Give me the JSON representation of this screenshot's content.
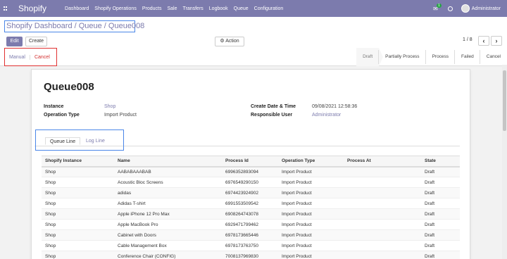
{
  "topbar": {
    "brand": "Shopify",
    "menu": [
      "Dashboard",
      "Shopify Operations",
      "Products",
      "Sale",
      "Transfers",
      "Logbook",
      "Queue",
      "Configuration"
    ],
    "chat_badge": "1",
    "user_name": "Administrator"
  },
  "control": {
    "breadcrumb": "Shopify Dashboard / Queue / Queue008",
    "edit_label": "Edit",
    "create_label": "Create",
    "action_label": "Action",
    "pager": "1 / 8"
  },
  "header": {
    "manual_label": "Manual",
    "cancel_label": "Cancel",
    "statuses": [
      "Draft",
      "Partially Process",
      "Process",
      "Failed",
      "Cancel"
    ],
    "active_status": "Draft"
  },
  "record": {
    "title": "Queue008",
    "instance_label": "Instance",
    "instance_value": "Shop",
    "operation_type_label": "Operation Type",
    "operation_type_value": "Import Product",
    "create_date_label": "Create Date & Time",
    "create_date_value": "09/08/2021 12:58:36",
    "responsible_label": "Responsible User",
    "responsible_value": "Administrator"
  },
  "tabs": [
    "Queue Line",
    "Log Line"
  ],
  "table": {
    "headers": [
      "Shopify Instance",
      "Name",
      "Process Id",
      "Operation Type",
      "Process At",
      "State"
    ],
    "rows": [
      [
        "Shop",
        "AABABAAABAB",
        "6996352893094",
        "Import Product",
        "",
        "Draft"
      ],
      [
        "Shop",
        "Acoustic Bloc Screens",
        "6976549290150",
        "Import Product",
        "",
        "Draft"
      ],
      [
        "Shop",
        "adidas",
        "6974423924902",
        "Import Product",
        "",
        "Draft"
      ],
      [
        "Shop",
        "Adidas T-shirt",
        "6991553509542",
        "Import Product",
        "",
        "Draft"
      ],
      [
        "Shop",
        "Apple iPhone 12 Pro Max",
        "6908264743078",
        "Import Product",
        "",
        "Draft"
      ],
      [
        "Shop",
        "Apple MacBook Pro",
        "6929471799462",
        "Import Product",
        "",
        "Draft"
      ],
      [
        "Shop",
        "Cabinet with Doors",
        "6978173665446",
        "Import Product",
        "",
        "Draft"
      ],
      [
        "Shop",
        "Cable Management Box",
        "6978173763750",
        "Import Product",
        "",
        "Draft"
      ],
      [
        "Shop",
        "Conference Chair (CONFIG)",
        "7008137969830",
        "Import Product",
        "",
        "Draft"
      ]
    ]
  },
  "colors": {
    "brand": "#7c7bad",
    "highlight_box": "#4a86e8",
    "cancel_red": "#d32f2f"
  }
}
